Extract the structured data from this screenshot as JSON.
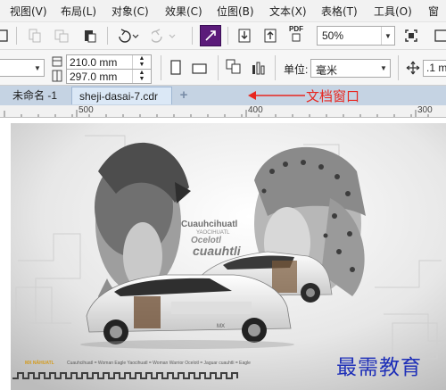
{
  "menu": [
    "视图(V)",
    "布局(L)",
    "对象(C)",
    "效果(C)",
    "位图(B)",
    "文本(X)",
    "表格(T)",
    "工具(O)",
    "窗"
  ],
  "toolbar": {
    "zoom_value": "50%",
    "pdf_label": "PDF"
  },
  "propbar": {
    "width_value": "210.0 mm",
    "height_value": "297.0 mm",
    "units_label": "单位:",
    "units_value": "毫米",
    "nudge_value": ".1 m"
  },
  "tabs": [
    {
      "label": "未命名 -1"
    },
    {
      "label": "sheji-dasai-7.cdr"
    }
  ],
  "new_tab_glyph": "+",
  "annotation": "文档窗口",
  "ruler_labels": [
    "500",
    "400",
    "300"
  ],
  "artwork": {
    "title_line1": "Cuauhcihuatl",
    "subtitle_line1": "YAOCIHUATL",
    "title_line2": "Ocelotl",
    "title_line3": "cuauhtli",
    "car_badge": "MX",
    "caption_brand": "MX NĀHUATL",
    "caption_text": "Cuauhcihuatl = Woman Eagle   Yaocihuatl = Woman Warrior   Ocelotl = Jaguar   cuauhtli = Eagle"
  },
  "watermark": "最需教育",
  "colors": {
    "tab_active": "#dbe8f6",
    "tab_strip": "#c5d3e3",
    "annotation_red": "#e8261f",
    "watermark_blue": "#1e2fb8",
    "effect_purple": "#5b1b7a"
  }
}
